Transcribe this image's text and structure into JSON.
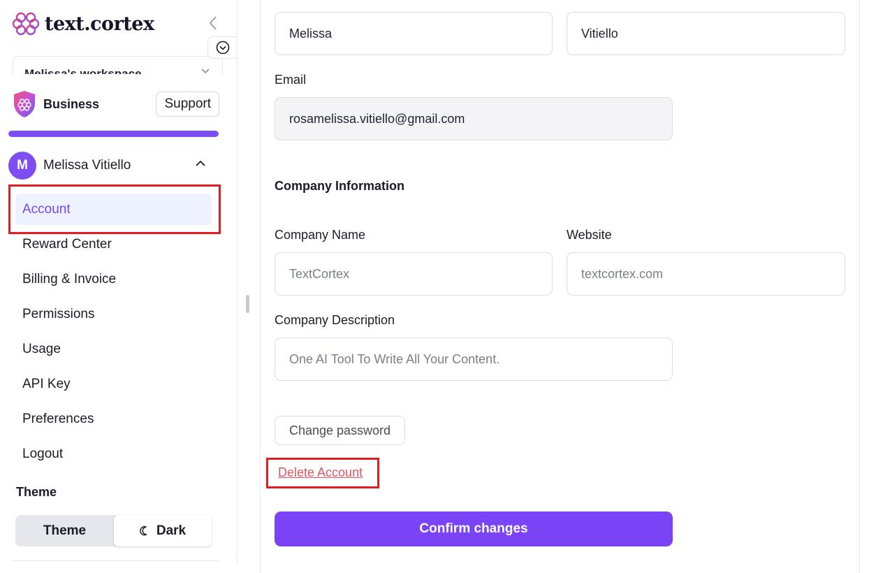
{
  "app": {
    "logo_text": "text.cortex",
    "brand_color": "#7c4df4"
  },
  "sidebar": {
    "workspace_name": "Melissa's workspace",
    "plan": {
      "name": "Business",
      "support_label": "Support",
      "usage_fraction": 1.0
    },
    "user": {
      "initial": "M",
      "name": "Melissa Vitiello"
    },
    "menu": [
      {
        "label": "Account",
        "active": true
      },
      {
        "label": "Reward Center",
        "active": false
      },
      {
        "label": "Billing & Invoice",
        "active": false
      },
      {
        "label": "Permissions",
        "active": false
      },
      {
        "label": "Usage",
        "active": false
      },
      {
        "label": "API Key",
        "active": false
      },
      {
        "label": "Preferences",
        "active": false
      },
      {
        "label": "Logout",
        "active": false
      }
    ],
    "theme": {
      "heading": "Theme",
      "options": [
        "Theme",
        "Dark"
      ],
      "selected": "Dark"
    }
  },
  "form": {
    "first_name": "Melissa",
    "last_name": "Vitiello",
    "email_label": "Email",
    "email_value": "rosamelissa.vitiello@gmail.com",
    "company_section_title": "Company Information",
    "company_name_label": "Company Name",
    "company_name_placeholder": "TextCortex",
    "website_label": "Website",
    "website_placeholder": "textcortex.com",
    "company_description_label": "Company Description",
    "company_description_placeholder": "One AI Tool To Write All Your Content.",
    "change_password_label": "Change password",
    "delete_account_label": "Delete Account",
    "confirm_label": "Confirm changes"
  },
  "annotations": {
    "highlight_color": "#e11d22"
  }
}
